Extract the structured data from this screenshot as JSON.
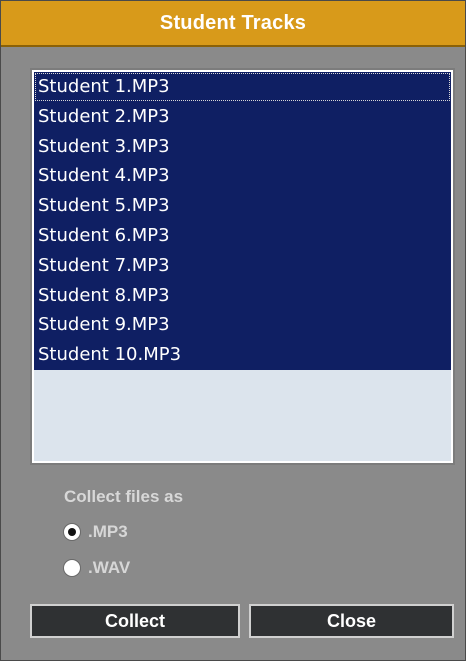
{
  "dialog": {
    "title": "Student Tracks",
    "tracks": [
      "Student 1.MP3",
      "Student 2.MP3",
      "Student 3.MP3",
      "Student 4.MP3",
      "Student 5.MP3",
      "Student 6.MP3",
      "Student 7.MP3",
      "Student 8.MP3",
      "Student 9.MP3",
      "Student 10.MP3"
    ],
    "collect_label": "Collect files as",
    "format_options": [
      {
        "label": ".MP3",
        "selected": true
      },
      {
        "label": ".WAV",
        "selected": false
      }
    ],
    "buttons": {
      "collect": "Collect",
      "close": "Close"
    },
    "colors": {
      "title_bar": "#d89a1a",
      "dialog_background": "#8a8a8a",
      "selected_item": "#0f1f63",
      "list_background": "#dce4ed",
      "button_background": "#2f3133"
    }
  }
}
